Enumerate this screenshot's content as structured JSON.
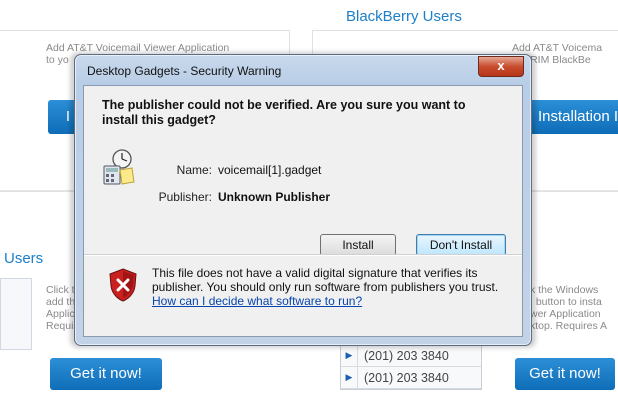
{
  "background": {
    "blackberry_title": "BlackBerry Users",
    "users_title": "Users",
    "left_text": "Add AT&T Voicemail Viewer Application\nto yo",
    "right_text": "Add AT&T Voicema\nour RIM BlackBe",
    "install_button_left": "I",
    "install_button_right": "Installation I",
    "left_col_text": "Click t\nadd th\nApplic\nRequir",
    "right_col_text": "k the Windows\n! button to insta\nwer Application\nktop. Requires A",
    "get_it_now_left": "Get it now!",
    "get_it_now_right": "Get it now!",
    "phone_numbers": [
      "(201) 203 3840",
      "(201) 203 3840"
    ]
  },
  "dialog": {
    "title": "Desktop Gadgets - Security Warning",
    "close_symbol": "x",
    "heading": "The publisher could not be verified. Are you sure you want to install this gadget?",
    "name_label": "Name:",
    "name_value": "voicemail[1].gadget",
    "publisher_label": "Publisher:",
    "publisher_value": "Unknown Publisher",
    "install_label": "Install",
    "dont_install_label": "Don't Install",
    "warning_text": "This file does not have a valid digital signature that verifies its publisher. You should only run software from publishers you trust.",
    "help_link": "How can I decide what software to run?"
  }
}
